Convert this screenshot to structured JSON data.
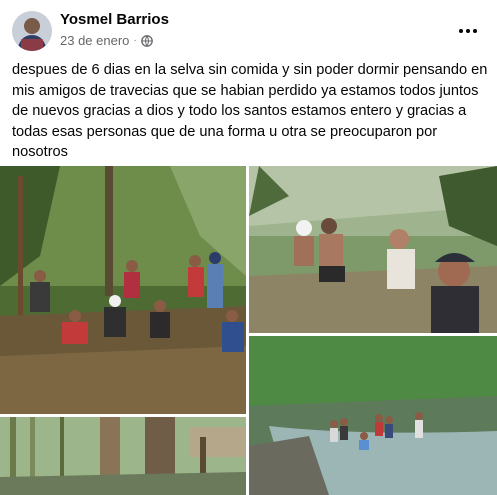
{
  "post": {
    "author": "Yosmel Barrios",
    "date": "23 de enero",
    "separator": "·",
    "privacy_icon": "globe-icon",
    "more_icon": "more-options-icon",
    "text": "despues de 6 dias en la selva sin comida y sin poder dormir pensando en mis amigos de travecias que se habian perdido ya estamos todos juntos de nuevos gracias a dios y todo los santos estamos entero y gracias a todas esas personas que de una forma u otra se preocuparon por nosotros"
  },
  "gallery": {
    "photos": [
      {
        "name": "photo-group-resting-in-jungle"
      },
      {
        "name": "photo-men-sitting-near-tree"
      },
      {
        "name": "photo-group-at-river"
      },
      {
        "name": "photo-bamboo-forest"
      }
    ]
  },
  "colors": {
    "text": "#050505",
    "meta": "#65676b",
    "background": "#ffffff"
  }
}
